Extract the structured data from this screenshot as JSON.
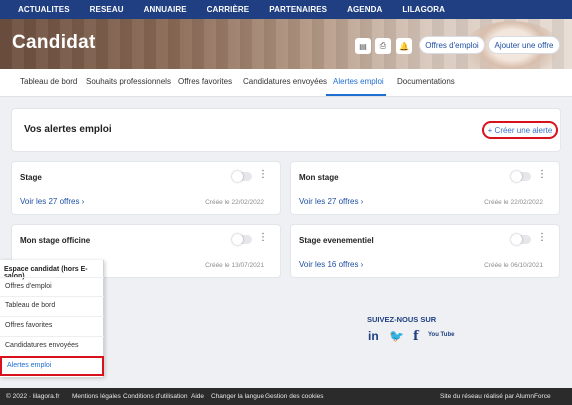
{
  "nav": [
    "ACTUALITES",
    "RESEAU",
    "ANNUAIRE",
    "CARRIÈRE",
    "PARTENAIRES",
    "AGENDA",
    "LILAGORA"
  ],
  "hero": {
    "title": "Candidat",
    "icons": [
      "document-icon",
      "print-icon",
      "bell-icon"
    ],
    "btn_offres": "Offres d'emploi",
    "btn_ajouter": "Ajouter une offre"
  },
  "tabs": [
    {
      "label": "Tableau de bord",
      "active": false
    },
    {
      "label": "Souhaits professionnels",
      "active": false
    },
    {
      "label": "Offres favorites",
      "active": false
    },
    {
      "label": "Candidatures envoyées",
      "active": false
    },
    {
      "label": "Alertes emploi",
      "active": true
    },
    {
      "label": "Documentations",
      "active": false
    }
  ],
  "alerts": {
    "title": "Vos alertes emploi",
    "create_label": "+ Créer une alerte",
    "items": [
      {
        "name": "Stage",
        "link": "Voir les 27 offres",
        "date": "Créée le 22/02/2022"
      },
      {
        "name": "Mon stage",
        "link": "Voir les 27 offres",
        "date": "Créée le 22/02/2022"
      },
      {
        "name": "Mon stage officine",
        "link": "",
        "date": "Créée le 13/07/2021"
      },
      {
        "name": "Stage evenementiel",
        "link": "Voir les 16 offres",
        "date": "Créée le 06/10/2021"
      }
    ]
  },
  "menu": {
    "head": "Espace candidat (hors E-salon)",
    "items": [
      "Offres d'emploi",
      "Tableau de bord",
      "Offres favorites",
      "Candidatures envoyées",
      "Alertes emploi"
    ]
  },
  "social": {
    "title": "SUIVEZ-NOUS SUR",
    "icons": [
      {
        "name": "linkedin-icon",
        "glyph": "in"
      },
      {
        "name": "twitter-icon",
        "glyph": "🐦"
      },
      {
        "name": "facebook-icon",
        "glyph": "f"
      },
      {
        "name": "youtube-icon",
        "glyph": "You Tube"
      }
    ]
  },
  "footer": {
    "copyright": "© 2022 · lilagora.fr",
    "links": [
      "Mentions légales",
      "Conditions d'utilisation",
      "Aide",
      "Changer la langue",
      "Gestion des cookies"
    ],
    "credit": "Site du réseau réalisé par AlumnForce"
  }
}
